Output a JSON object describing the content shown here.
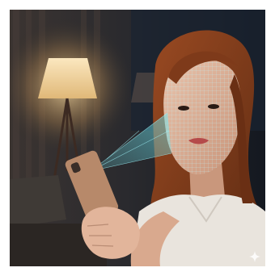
{
  "scene": {
    "subject": "woman-using-face-id",
    "accent_scan": "#5fd3e0",
    "lamp_glow": "#f2d39a",
    "hair": "#8a3f1c",
    "shirt": "#e9e4dd",
    "phone": "#b7896a",
    "watermark_icon": "sparkle-icon"
  }
}
